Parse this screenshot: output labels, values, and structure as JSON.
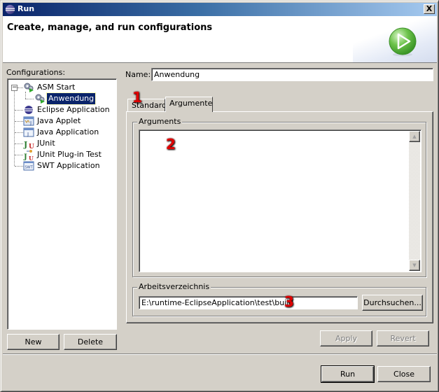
{
  "window": {
    "title": "Run",
    "close_glyph": "X",
    "banner_heading": "Create, manage, and run configurations"
  },
  "configurations": {
    "label": "Configurations:",
    "label_mnemonic": "f",
    "tree": [
      {
        "label": "ASM Start",
        "icon": "launch-config-gears-icon",
        "level": 0,
        "expanded": true
      },
      {
        "label": "Anwendung",
        "icon": "launch-config-gears-icon",
        "level": 1,
        "selected": true
      },
      {
        "label": "Eclipse Application",
        "icon": "eclipse-icon",
        "level": 0
      },
      {
        "label": "Java Applet",
        "icon": "java-applet-icon",
        "level": 0
      },
      {
        "label": "Java Application",
        "icon": "java-application-icon",
        "level": 0
      },
      {
        "label": "JUnit",
        "icon": "junit-icon",
        "level": 0
      },
      {
        "label": "JUnit Plug-in Test",
        "icon": "junit-plugin-icon",
        "level": 0
      },
      {
        "label": "SWT Application",
        "icon": "swt-icon",
        "level": 0
      }
    ],
    "new_button": "New",
    "delete_button": "Delete"
  },
  "editor": {
    "name_label": "Name:",
    "name_value": "Anwendung",
    "tabs": [
      {
        "label": "Standard",
        "active": false
      },
      {
        "label": "Argumente",
        "active": true
      }
    ],
    "arguments_group": "Arguments",
    "arguments_value": "",
    "workdir_group": "Arbeitsverzeichnis",
    "workdir_value": "E:\\runtime-EclipseApplication\\test\\build",
    "browse_button": "Durchsuchen...",
    "apply_button": "Apply",
    "revert_button": "Revert"
  },
  "footer": {
    "run_button": "Run",
    "close_button": "Close"
  },
  "annotations": [
    "1",
    "2",
    "3"
  ],
  "colors": {
    "titlebar_start": "#0a246a",
    "titlebar_end": "#a6caf0",
    "selection": "#0a246a",
    "dialog_bg": "#d4d0c8",
    "annotation_red": "#e00000"
  }
}
